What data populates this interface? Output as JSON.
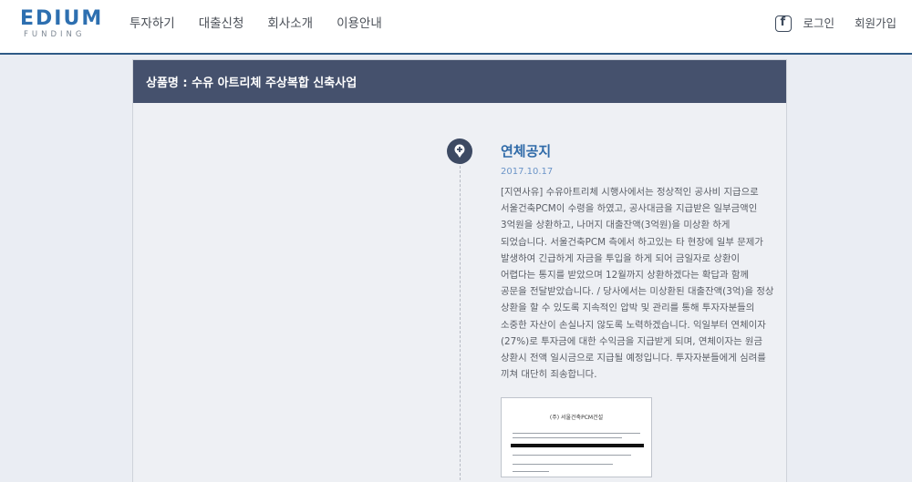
{
  "header": {
    "logo_main": "EDIUM",
    "logo_sub": "FUNDING",
    "nav": [
      "투자하기",
      "대출신청",
      "회사소개",
      "이용안내"
    ],
    "login": "로그인",
    "signup": "회원가입",
    "facebook_icon": "facebook-icon"
  },
  "card": {
    "title": "상품명 : 수유 아트리체 주상복합 신축사업",
    "notice": {
      "title": "연체공지",
      "date": "2017.10.17",
      "body": "[지연사유] 수유아트리체 시행사에서는 정상적인 공사비 지급으로 서울건축PCM이 수령을 하였고, 공사대금을 지급받은 일부금액인 3억원을 상환하고, 나머지 대출잔액(3억원)을 미상환 하게 되었습니다. 서울건축PCM 측에서 하고있는 타 현장에 일부 문제가 발생하여 긴급하게 자금을 투입을 하게 되어 금일자로 상환이 어렵다는 통지를 받았으며 12월까지 상환하겠다는 확답과 함께 공문을 전달받았습니다. / 당사에서는 미상환된 대출잔액(3억)을 정상 상환을 할 수 있도록 지속적인 압박 및 관리를 통해 투자자분들의 소중한 자산이 손실나지 않도록 노력하겠습니다. 익일부터 연체이자(27%)로 투자금에 대한 수익금을 지급받게 되며, 연체이자는 원금 상환시 전액 일시금으로 지급될 예정입니다. 투자자분들에게 심려를 끼쳐 대단히 죄송합니다.",
      "document_heading": "(주) 서울건축PCM건설"
    }
  }
}
